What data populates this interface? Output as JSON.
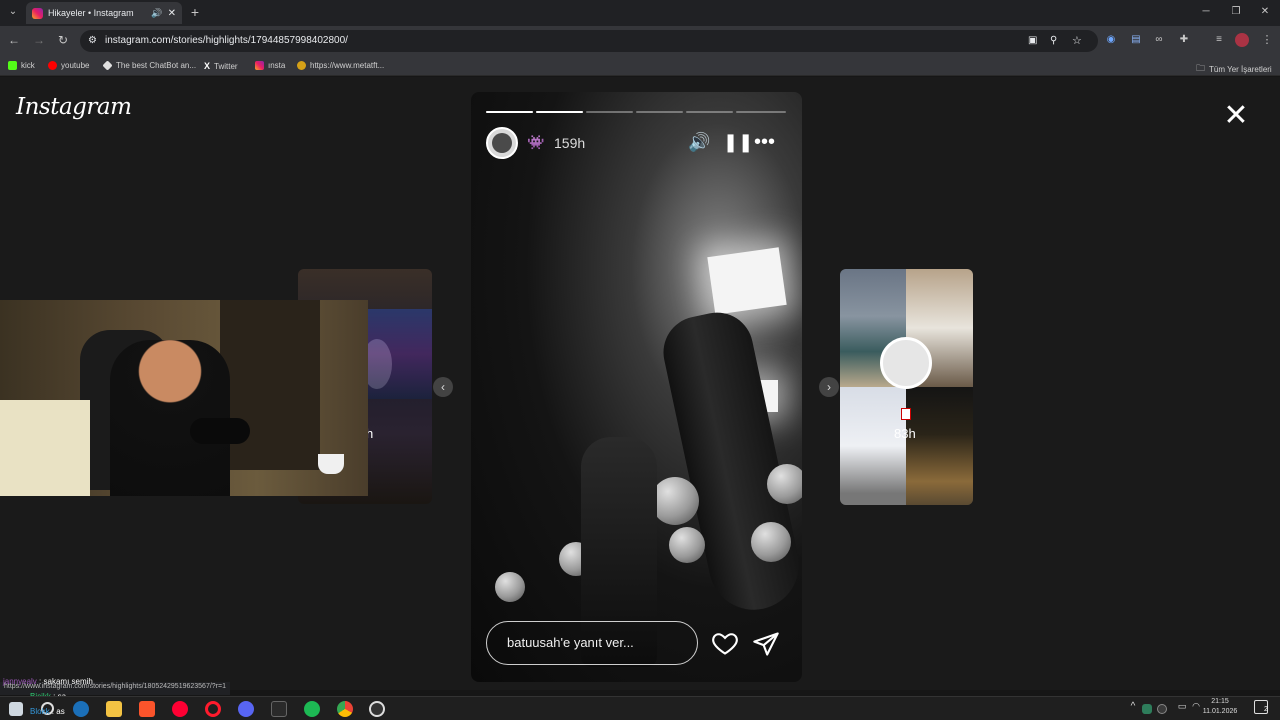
{
  "browser": {
    "tab_title": "Hikayeler • Instagram",
    "new_tab_symbol": "+",
    "url": "instagram.com/stories/highlights/17944857998402800/",
    "bookmarks": [
      {
        "label": "kick",
        "icon": "kick-icon",
        "color": "#53fc18"
      },
      {
        "label": "youtube",
        "icon": "youtube-icon",
        "color": "#ff0000"
      },
      {
        "label": "The best ChatBot an...",
        "icon": "chatbot-icon",
        "color": "#e0e0e0"
      },
      {
        "label": "Twitter",
        "icon": "x-icon",
        "color": "#ffffff"
      },
      {
        "label": "ınsta",
        "icon": "instagram-icon",
        "color": "#e1306c"
      },
      {
        "label": "https://www.metatft...",
        "icon": "metatft-icon",
        "color": "#d4a017"
      }
    ],
    "all_bookmarks_label": "Tüm Yer İşaretleri"
  },
  "page": {
    "logo": "Instagram"
  },
  "story": {
    "time": "159h",
    "progress": [
      1,
      1,
      0,
      0,
      0,
      0
    ],
    "reply_placeholder": "batuusah'e yanıt ver...",
    "accent": "#ffffff"
  },
  "side_preview_right": {
    "time": "83h"
  },
  "side_preview_left": {
    "time_fragment": "h"
  },
  "overlay": {
    "status_url": "https://www.instagram.com/stories/highlights/18052429519623567/?r=1",
    "chat": [
      {
        "user": "jannyealv",
        "message": "sakamı semih",
        "color": "#9b59b6"
      },
      {
        "user": "Bicikk",
        "message": "sa",
        "color": "#2ecc71"
      },
      {
        "user": "Blokk",
        "message": "as",
        "color": "#3498db"
      }
    ]
  },
  "taskbar": {
    "time": "21:15",
    "date": "11.01.2026",
    "notification_count": "2"
  }
}
